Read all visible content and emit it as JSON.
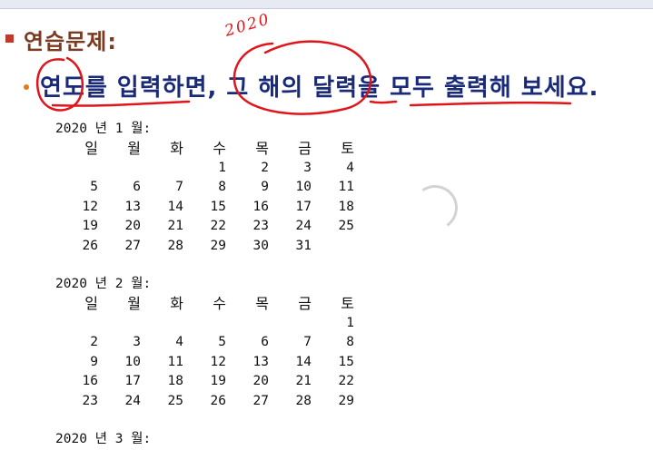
{
  "title": "연습문제:",
  "instruction": "연도를 입력하면, 그 해의 달력을 모두 출력해 보세요.",
  "annotation": "2020",
  "weekdays": [
    "일",
    "월",
    "화",
    "수",
    "목",
    "금",
    "토"
  ],
  "months": [
    {
      "header": "2020 년 1 월:",
      "weeks": [
        [
          "",
          "",
          "",
          "1",
          "2",
          "3",
          "4"
        ],
        [
          "5",
          "6",
          "7",
          "8",
          "9",
          "10",
          "11"
        ],
        [
          "12",
          "13",
          "14",
          "15",
          "16",
          "17",
          "18"
        ],
        [
          "19",
          "20",
          "21",
          "22",
          "23",
          "24",
          "25"
        ],
        [
          "26",
          "27",
          "28",
          "29",
          "30",
          "31",
          ""
        ]
      ]
    },
    {
      "header": "2020 년 2 월:",
      "weeks": [
        [
          "",
          "",
          "",
          "",
          "",
          "",
          "1"
        ],
        [
          "2",
          "3",
          "4",
          "5",
          "6",
          "7",
          "8"
        ],
        [
          "9",
          "10",
          "11",
          "12",
          "13",
          "14",
          "15"
        ],
        [
          "16",
          "17",
          "18",
          "19",
          "20",
          "21",
          "22"
        ],
        [
          "23",
          "24",
          "25",
          "26",
          "27",
          "28",
          "29"
        ]
      ]
    },
    {
      "header": "2020 년 3 월:",
      "weeks": []
    }
  ],
  "colors": {
    "title": "#7a3b22",
    "instruction": "#1a2a78",
    "ink": "#e0151b",
    "bullet_square": "#c0392b",
    "bullet_dot": "#e07b1c"
  }
}
